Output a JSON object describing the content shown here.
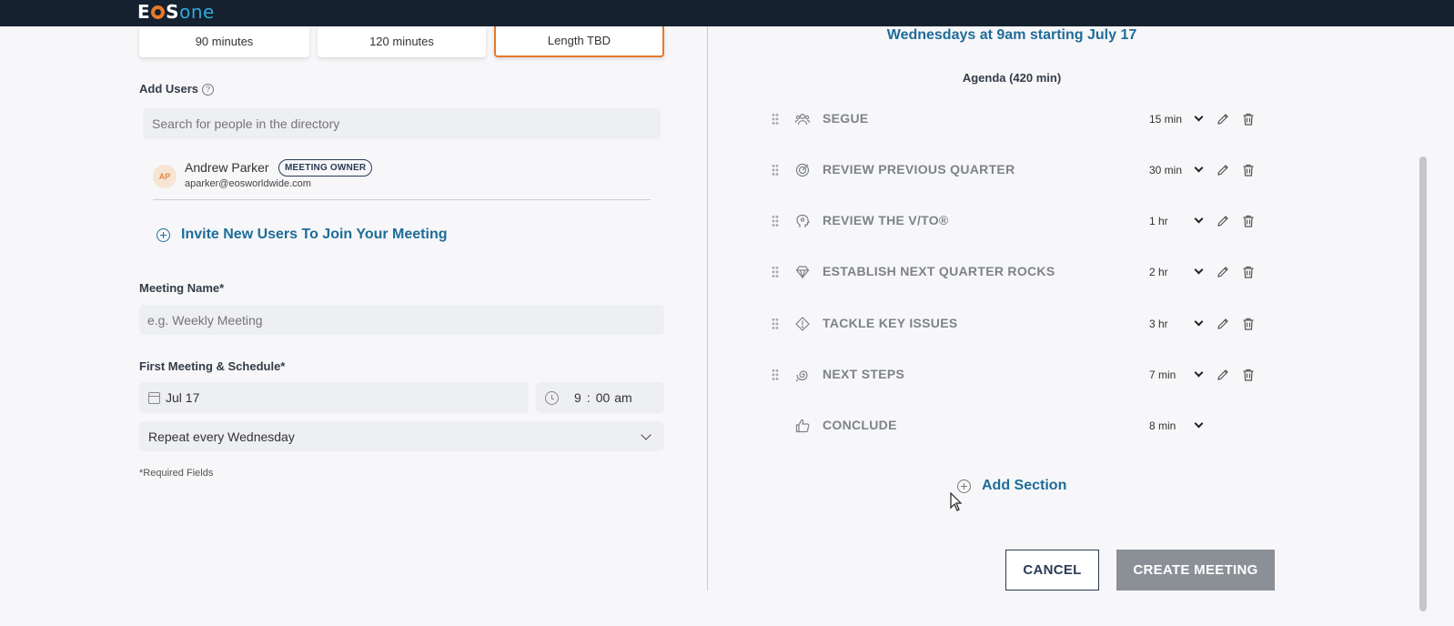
{
  "app": {
    "logo_text_left": "E",
    "logo_text_mid": "S",
    "logo_text_right": "one"
  },
  "durations": [
    {
      "label": "90 minutes",
      "selected": false
    },
    {
      "label": "120 minutes",
      "selected": false
    },
    {
      "label": "Length TBD",
      "selected": true
    }
  ],
  "add_users": {
    "label": "Add Users",
    "help": "?",
    "search_placeholder": "Search for people in the directory",
    "user": {
      "initials": "AP",
      "name": "Andrew Parker",
      "badge": "MEETING OWNER",
      "email": "aparker@eosworldwide.com"
    },
    "invite_label": "Invite New Users To Join Your Meeting"
  },
  "meeting_name": {
    "label": "Meeting Name*",
    "placeholder": "e.g. Weekly Meeting"
  },
  "schedule": {
    "label": "First Meeting & Schedule*",
    "date": "Jul 17",
    "time_hour": "9",
    "time_minute": "00",
    "time_ampm": "am",
    "repeat": "Repeat every Wednesday",
    "required_note": "*Required Fields"
  },
  "summary": {
    "schedule_title": "Wednesdays at 9am starting July 17",
    "agenda_title": "Agenda (420 min)"
  },
  "agenda": [
    {
      "name": "SEGUE",
      "time": "15 min",
      "icon": "people-icon",
      "editable": true
    },
    {
      "name": "REVIEW PREVIOUS QUARTER",
      "time": "30 min",
      "icon": "target-icon",
      "editable": true
    },
    {
      "name": "REVIEW THE V/TO®",
      "time": "1 hr",
      "icon": "head-icon",
      "editable": true
    },
    {
      "name": "ESTABLISH NEXT QUARTER ROCKS",
      "time": "2 hr",
      "icon": "gem-icon",
      "editable": true
    },
    {
      "name": "TACKLE KEY ISSUES",
      "time": "3 hr",
      "icon": "alert-diamond-icon",
      "editable": true
    },
    {
      "name": "NEXT STEPS",
      "time": "7 min",
      "icon": "spiral-icon",
      "editable": true
    },
    {
      "name": "CONCLUDE",
      "time": "8 min",
      "icon": "thumbs-up-icon",
      "editable": false
    }
  ],
  "add_section_label": "Add Section",
  "buttons": {
    "cancel": "CANCEL",
    "create": "CREATE MEETING"
  },
  "colors": {
    "accent": "#1f6c98",
    "selected_border": "#e8792b",
    "topbar": "#15212e",
    "disabled_button": "#8b9096"
  }
}
